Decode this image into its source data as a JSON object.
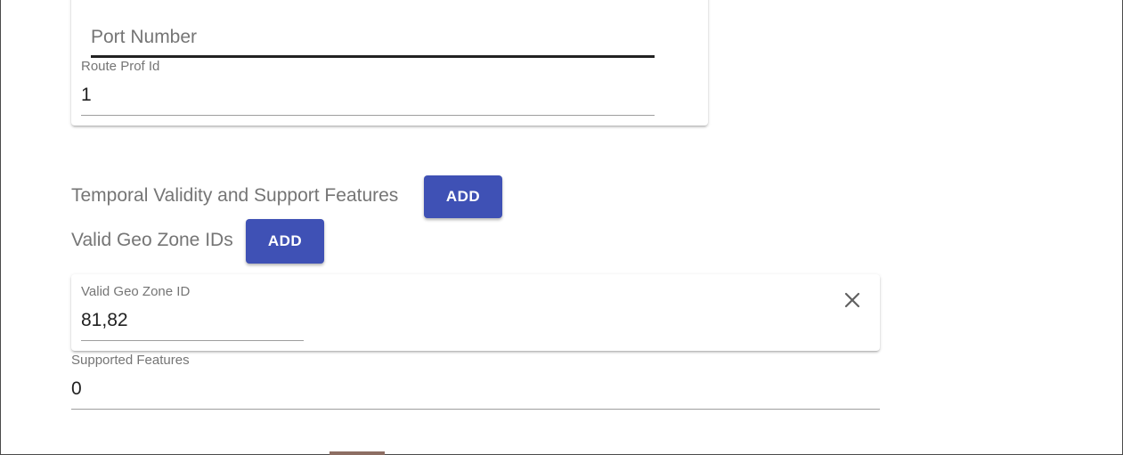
{
  "network_card": {
    "port_number": {
      "placeholder": "Port Number",
      "value": ""
    },
    "route_prof_id": {
      "label": "Route Prof Id",
      "value": "1"
    }
  },
  "temporal_section": {
    "label": "Temporal Validity and Support Features",
    "add_label": "ADD"
  },
  "geo_zone_section": {
    "label": "Valid Geo Zone IDs",
    "add_label": "ADD",
    "items": [
      {
        "label": "Valid Geo Zone ID",
        "value": "81,82",
        "remove_icon": "close-icon"
      }
    ]
  },
  "supported_features": {
    "label": "Supported Features",
    "value": "0"
  },
  "colors": {
    "primary": "#3f51b5",
    "label": "#757575",
    "text": "#212121"
  }
}
